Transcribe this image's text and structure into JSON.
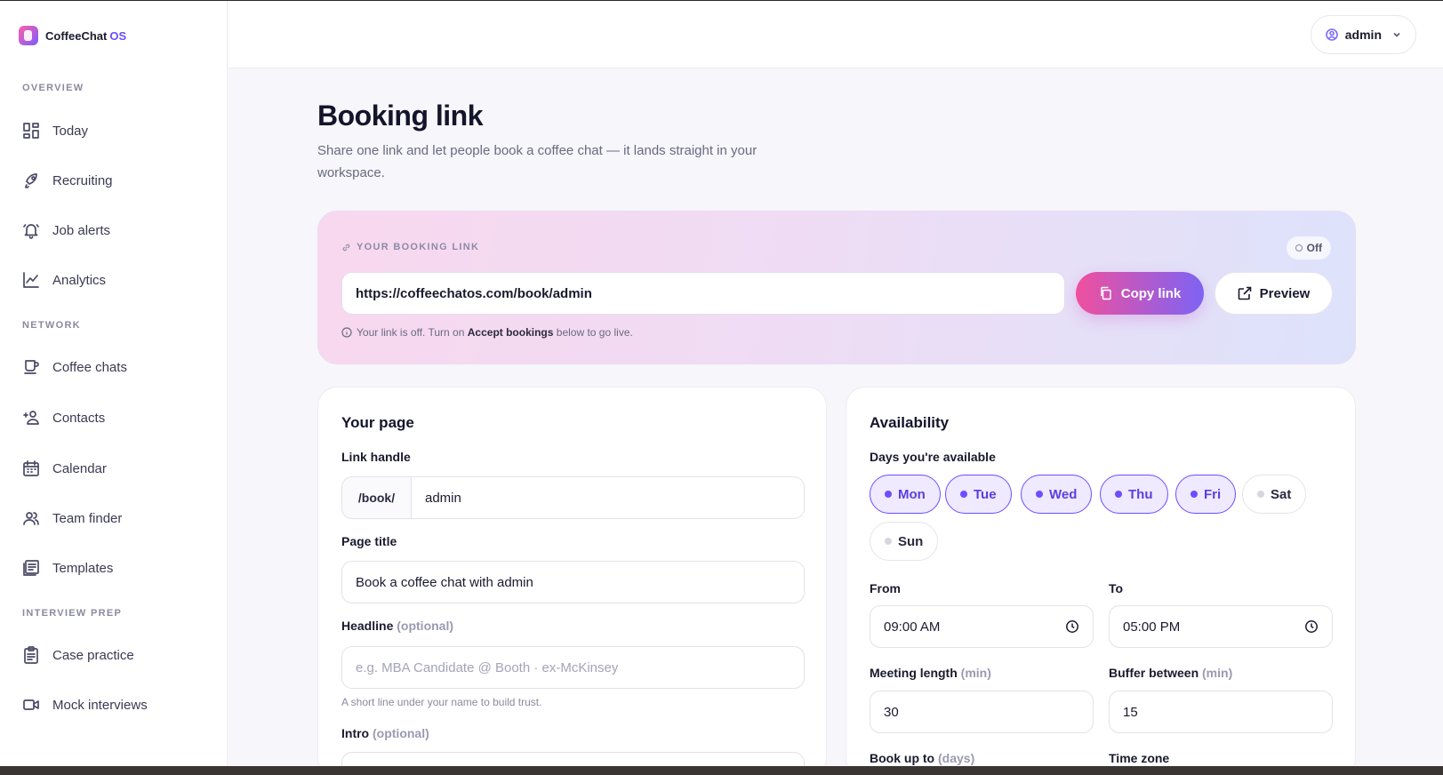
{
  "brand": {
    "name": "CoffeeChat",
    "suffix": "OS"
  },
  "header": {
    "user": "admin"
  },
  "sidebar": {
    "sections": [
      {
        "label": "OVERVIEW",
        "items": [
          {
            "label": "Today",
            "icon": "dashboard-icon"
          },
          {
            "label": "Recruiting",
            "icon": "rocket-icon"
          },
          {
            "label": "Job alerts",
            "icon": "bell-icon"
          },
          {
            "label": "Analytics",
            "icon": "chart-line-icon"
          }
        ]
      },
      {
        "label": "NETWORK",
        "items": [
          {
            "label": "Coffee chats",
            "icon": "coffee-cup-icon"
          },
          {
            "label": "Contacts",
            "icon": "contacts-icon"
          },
          {
            "label": "Calendar",
            "icon": "calendar-icon"
          },
          {
            "label": "Team finder",
            "icon": "team-icon"
          },
          {
            "label": "Templates",
            "icon": "templates-icon"
          }
        ]
      },
      {
        "label": "INTERVIEW PREP",
        "items": [
          {
            "label": "Case practice",
            "icon": "clipboard-icon"
          },
          {
            "label": "Mock interviews",
            "icon": "video-icon"
          }
        ]
      }
    ]
  },
  "page": {
    "title": "Booking link",
    "description": "Share one link and let people book a coffee chat — it lands straight in your workspace."
  },
  "link_card": {
    "label": "YOUR BOOKING LINK",
    "status": "Off",
    "url": "https://coffeechatos.com/book/admin",
    "copy_label": "Copy link",
    "preview_label": "Preview",
    "note_prefix": "Your link is off. Turn on ",
    "note_bold": "Accept bookings",
    "note_suffix": " below to go live."
  },
  "your_page": {
    "title": "Your page",
    "handle_label": "Link handle",
    "handle_prefix": "/book/",
    "handle_value": "admin",
    "page_title_label": "Page title",
    "page_title_value": "Book a coffee chat with admin",
    "headline_label": "Headline",
    "headline_optional": "(optional)",
    "headline_placeholder": "e.g. MBA Candidate @ Booth · ex-McKinsey",
    "headline_help": "A short line under your name to build trust.",
    "intro_label": "Intro",
    "intro_optional": "(optional)"
  },
  "availability": {
    "title": "Availability",
    "days_label": "Days you're available",
    "days": [
      {
        "label": "Mon",
        "on": true
      },
      {
        "label": "Tue",
        "on": true
      },
      {
        "label": "Wed",
        "on": true
      },
      {
        "label": "Thu",
        "on": true
      },
      {
        "label": "Fri",
        "on": true
      },
      {
        "label": "Sat",
        "on": false
      },
      {
        "label": "Sun",
        "on": false
      }
    ],
    "from_label": "From",
    "from_value": "09:00 AM",
    "to_label": "To",
    "to_value": "05:00 PM",
    "length_label": "Meeting length",
    "length_unit": "(min)",
    "length_value": "30",
    "buffer_label": "Buffer between",
    "buffer_unit": "(min)",
    "buffer_value": "15",
    "bookup_label": "Book up to",
    "bookup_unit": "(days)",
    "timezone_label": "Time zone"
  },
  "colors": {
    "accent": "#6c4dff",
    "pink": "#f0509e"
  }
}
